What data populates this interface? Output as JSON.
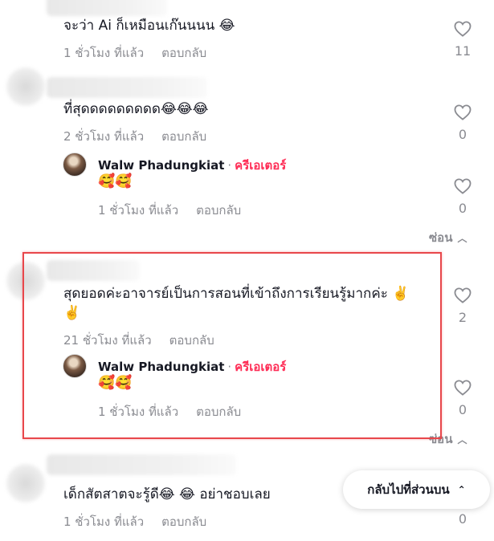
{
  "comments": [
    {
      "text": "จะว่า Ai ก็เหมือนเก๊นนนน 😂",
      "time": "1 ชั่วโมง ที่แล้ว",
      "reply_label": "ตอบกลับ",
      "likes": "11"
    },
    {
      "text": "ที่สุดดดดดดดดด😂😂😂",
      "time": "2 ชั่วโมง ที่แล้ว",
      "reply_label": "ตอบกลับ",
      "likes": "0",
      "reply": {
        "author": "Walw Phadungkiat",
        "separator": "·",
        "badge": "ครีเอเตอร์",
        "text": "🥰🥰",
        "time": "1 ชั่วโมง ที่แล้ว",
        "reply_label": "ตอบกลับ",
        "likes": "0"
      },
      "hide_label": "ซ่อน"
    },
    {
      "text_line1": "สุดยอดค่ะอาจารย์เป็นการสอนที่เข้าถึงการเรียนรู้มากค่ะ ✌️",
      "text_line2": "✌️",
      "time": "21 ชั่วโมง ที่แล้ว",
      "reply_label": "ตอบกลับ",
      "likes": "2",
      "reply": {
        "author": "Walw Phadungkiat",
        "separator": "·",
        "badge": "ครีเอเตอร์",
        "text": "🥰🥰",
        "time": "1 ชั่วโมง ที่แล้ว",
        "reply_label": "ตอบกลับ",
        "likes": "0"
      },
      "hide_label": "ซ่อน"
    },
    {
      "text": "เด็กสัตสาตจะรู้ดี😂 😂  อย่าชอบเลย",
      "time": "1 ชั่วโมง ที่แล้ว",
      "reply_label": "ตอบกลับ",
      "likes": "0"
    }
  ],
  "back_to_top": "กลับไปที่ส่วนบน",
  "colors": {
    "creator_badge": "#fe2c55",
    "highlight_border": "#e8474b",
    "muted_text": "#8a8b91"
  }
}
